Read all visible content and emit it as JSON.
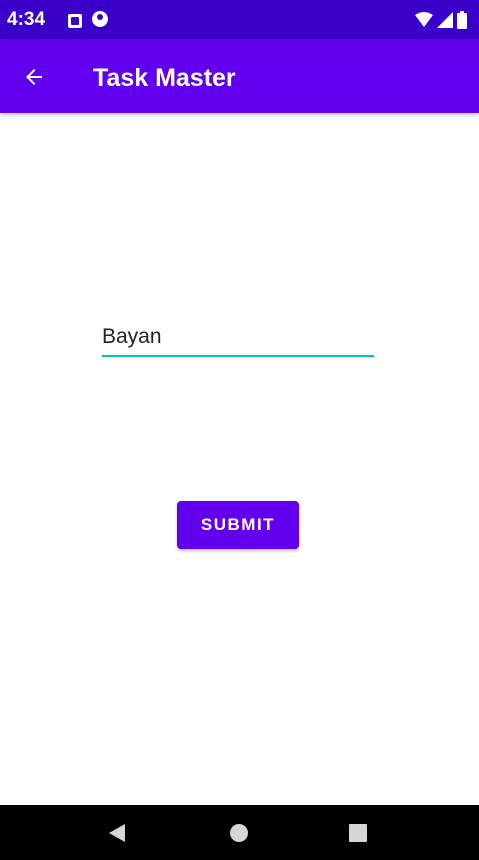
{
  "status_bar": {
    "time": "4:34",
    "icons": [
      "notification-a-icon",
      "notification-b-icon",
      "wifi-icon",
      "cell-signal-icon",
      "battery-icon"
    ]
  },
  "app_bar": {
    "back_icon": "arrow-left-icon",
    "title": "Task Master"
  },
  "form": {
    "name_value": "Bayan",
    "submit_label": "SUBMIT"
  },
  "nav_bar": {
    "icons": [
      "nav-back-icon",
      "nav-home-icon",
      "nav-recents-icon"
    ]
  },
  "colors": {
    "status_bar": "#3a00c9",
    "primary": "#6200ee",
    "accent": "#03c6b8",
    "nav_bar": "#000000",
    "background": "#ffffff"
  }
}
